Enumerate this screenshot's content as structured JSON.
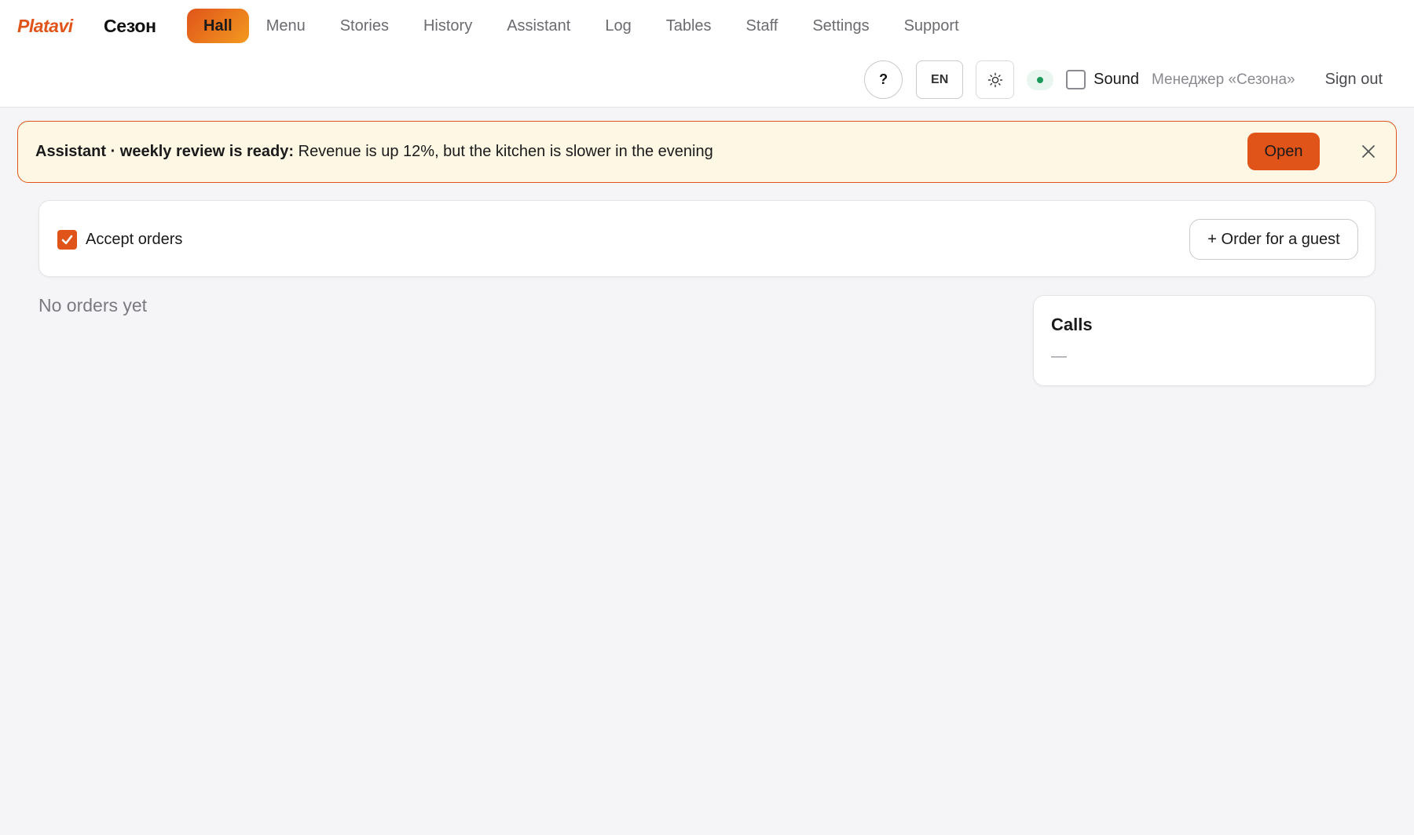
{
  "brand": {
    "logo": "Platavi",
    "venue": "Сезон"
  },
  "nav": [
    {
      "label": "Hall",
      "active": true
    },
    {
      "label": "Menu"
    },
    {
      "label": "Stories"
    },
    {
      "label": "History"
    },
    {
      "label": "Assistant"
    },
    {
      "label": "Log"
    },
    {
      "label": "Tables"
    },
    {
      "label": "Staff"
    },
    {
      "label": "Settings"
    },
    {
      "label": "Support"
    }
  ],
  "toolbar": {
    "help_label": "?",
    "lang_label": "EN",
    "theme_icon": "sun-icon",
    "status_color": "#1a9a5a",
    "sound_label": "Sound",
    "sound_checked": false,
    "manager_name": "Менеджер «Сезона»",
    "signout_label": "Sign out"
  },
  "banner": {
    "title": "Assistant · weekly review is ready:",
    "message": " Revenue is up 12%, but the kitchen is slower in the evening",
    "open_label": "Open",
    "close_icon": "close-icon"
  },
  "orders": {
    "accept_label": "Accept orders",
    "accept_checked": true,
    "guest_order_label": "+ Order for a guest",
    "empty_text": "No orders yet"
  },
  "calls": {
    "title": "Calls",
    "value": "—"
  },
  "colors": {
    "accent": "#e0541a",
    "accent_gradient_end": "#f39a1f",
    "banner_bg": "#fdf7e4",
    "page_bg": "#f5f5f7"
  }
}
